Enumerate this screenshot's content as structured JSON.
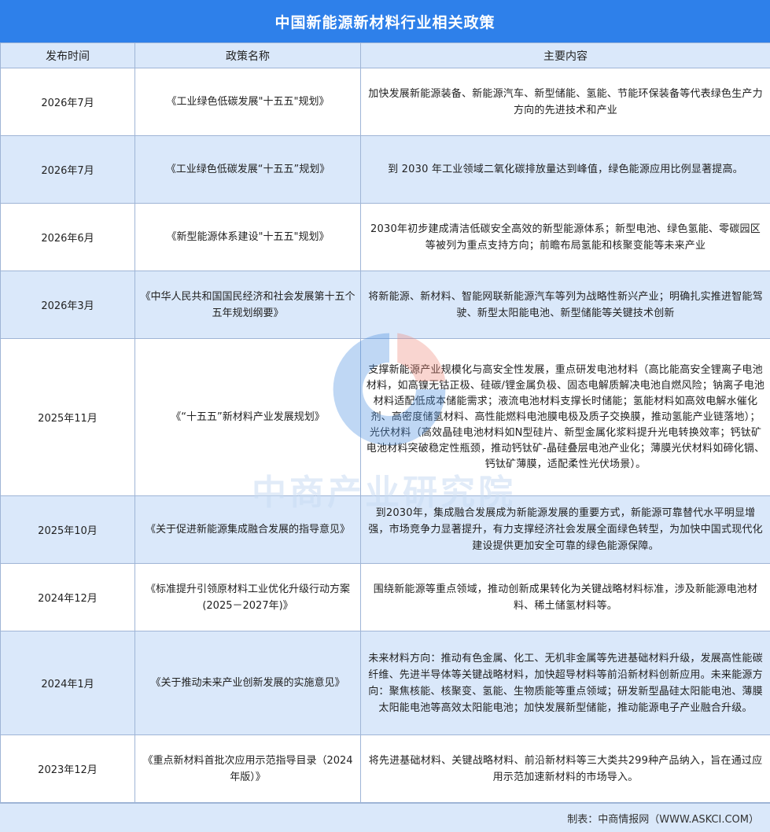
{
  "title": "中国新能源新材料行业相关政策",
  "headers": {
    "date": "发布时间",
    "name": "政策名称",
    "content": "主要内容"
  },
  "rows": [
    {
      "date": "2026年7月",
      "name": "《工业绿色低碳发展\"十五五\"规划》",
      "content": "加快发展新能源装备、新能源汽车、新型储能、氢能、节能环保装备等代表绿色生产力方向的先进技术和产业"
    },
    {
      "date": "2026年7月",
      "name": "《工业绿色低碳发展“十五五”规划》",
      "content": "到 2030 年工业领域二氧化碳排放量达到峰值，绿色能源应用比例显著提高。"
    },
    {
      "date": "2026年6月",
      "name": "《新型能源体系建设\"十五五\"规划》",
      "content": "2030年初步建成清洁低碳安全高效的新型能源体系；新型电池、绿色氢能、零碳园区等被列为重点支持方向；前瞻布局氢能和核聚变能等未来产业"
    },
    {
      "date": "2026年3月",
      "name": "《中华人民共和国国民经济和社会发展第十五个五年规划纲要》",
      "content": "将新能源、新材料、智能网联新能源汽车等列为战略性新兴产业；明确扎实推进智能驾驶、新型太阳能电池、新型储能等关键技术创新"
    },
    {
      "date": "2025年11月",
      "name": "《“十五五”新材料产业发展规划》",
      "content": "支撑新能源产业规模化与高安全性发展，重点研发电池材料（高比能高安全锂离子电池材料，如高镍无钴正极、硅碳/锂金属负极、固态电解质解决电池自燃风险；钠离子电池材料适配低成本储能需求；液流电池材料支撑长时储能；氢能材料如高效电解水催化剂、高密度储氢材料、高性能燃料电池膜电极及质子交换膜，推动氢能产业链落地）；光伏材料（高效晶硅电池材料如N型硅片、新型金属化浆料提升光电转换效率；钙钛矿电池材料突破稳定性瓶颈，推动钙钛矿-晶硅叠层电池产业化；薄膜光伏材料如碲化镉、钙钛矿薄膜，适配柔性光伏场景）。"
    },
    {
      "date": "2025年10月",
      "name": "《关于促进新能源集成融合发展的指导意见》",
      "content": "到2030年，集成融合发展成为新能源发展的重要方式，新能源可靠替代水平明显增强，市场竞争力显著提升，有力支撑经济社会发展全面绿色转型，为加快中国式现代化建设提供更加安全可靠的绿色能源保障。"
    },
    {
      "date": "2024年12月",
      "name": "《标准提升引领原材料工业优化升级行动方案(2025－2027年)》",
      "content": "围绕新能源等重点领域，推动创新成果转化为关键战略材料标准，涉及新能源电池材料、稀土储氢材料等。"
    },
    {
      "date": "2024年1月",
      "name": "《关于推动未来产业创新发展的实施意见》",
      "content": "未来材料方向：推动有色金属、化工、无机非金属等先进基础材料升级，发展高性能碳纤维、先进半导体等关键战略材料，加快超导材料等前沿新材料创新应用。未来能源方向：聚焦核能、核聚变、氢能、生物质能等重点领域；研发新型晶硅太阳能电池、薄膜太阳能电池等高效太阳能电池；加快发展新型储能，推动能源电子产业融合升级。"
    },
    {
      "date": "2023年12月",
      "name": "《重点新材料首批次应用示范指导目录（2024 年版）》",
      "content": "将先进基础材料、关键战略材料、前沿新材料等三大类共299种产品纳入，旨在通过应用示范加速新材料的市场导入。"
    }
  ],
  "footer": "制表：中商情报网（WWW.ASKCI.COM）",
  "watermark": "中商产业研究院",
  "colors": {
    "title_bg": "#2e80ea",
    "alt_row": "#dae8fa",
    "border": "#9fb5d6"
  }
}
